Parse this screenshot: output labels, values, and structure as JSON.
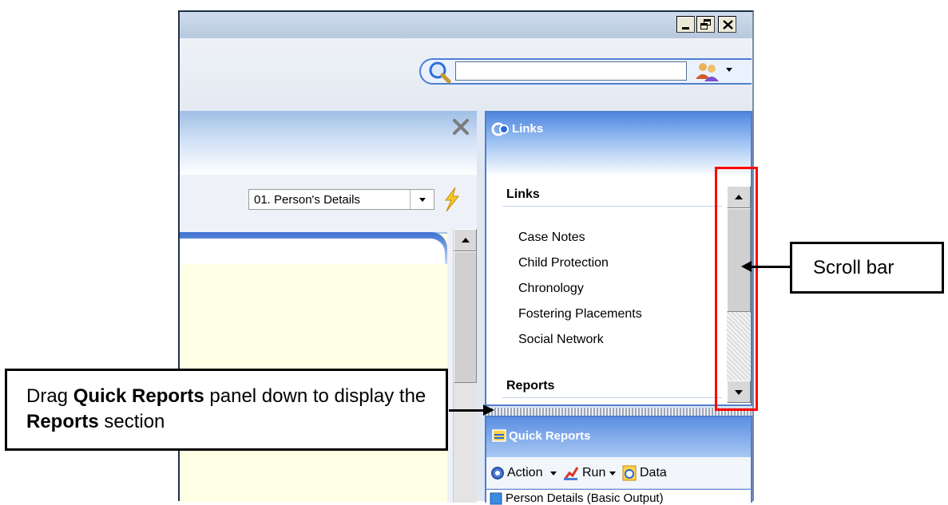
{
  "window": {
    "minimize_glyph": "_",
    "restore_glyph": "²",
    "close_glyph": "×"
  },
  "search": {
    "value": "",
    "placeholder": ""
  },
  "main": {
    "close_glyph": "✕",
    "form_dropdown": {
      "selected": "01. Person's Details",
      "arrow": "▾"
    }
  },
  "links_panel": {
    "title": "Links",
    "section_links": "Links",
    "items": [
      "Case Notes",
      "Child Protection",
      "Chronology",
      "Fostering Placements",
      "Social Network"
    ],
    "section_reports": "Reports"
  },
  "quick_reports": {
    "title": "Quick Reports",
    "action_label": "Action",
    "run_label": "Run",
    "data_label": "Data",
    "first_row": "Person Details (Basic Output)"
  },
  "annotations": {
    "scroll_bar": "Scroll bar",
    "drag_prefix": "Drag ",
    "drag_bold1": "Quick Reports",
    "drag_mid": " panel down to display the ",
    "drag_bold2": "Reports",
    "drag_suffix": " section"
  },
  "colors": {
    "accent": "#4e7fd0",
    "highlight": "#ff0000",
    "form_bg": "#ffffe6"
  }
}
